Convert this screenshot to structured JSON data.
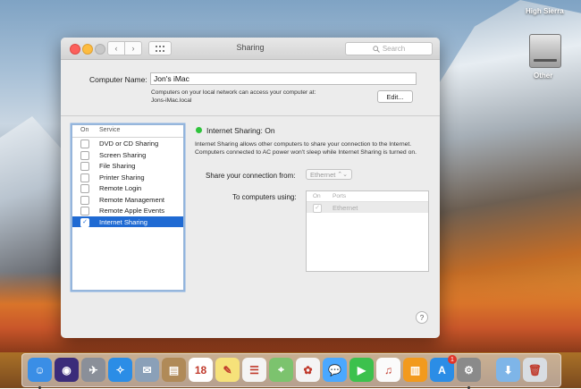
{
  "desktop": {
    "top_label": "High Sierra",
    "drive_label": "Other"
  },
  "window": {
    "title": "Sharing",
    "search_placeholder": "Search",
    "computer_name_label": "Computer Name:",
    "computer_name_value": "Jon's iMac",
    "computer_name_desc_line1": "Computers on your local network can access your computer at:",
    "computer_name_desc_line2": "Jons-iMac.local",
    "edit_button": "Edit...",
    "service_list": {
      "col_on": "On",
      "col_service": "Service",
      "items": [
        {
          "label": "DVD or CD Sharing",
          "checked": false,
          "selected": false
        },
        {
          "label": "Screen Sharing",
          "checked": false,
          "selected": false
        },
        {
          "label": "File Sharing",
          "checked": false,
          "selected": false
        },
        {
          "label": "Printer Sharing",
          "checked": false,
          "selected": false
        },
        {
          "label": "Remote Login",
          "checked": false,
          "selected": false
        },
        {
          "label": "Remote Management",
          "checked": false,
          "selected": false
        },
        {
          "label": "Remote Apple Events",
          "checked": false,
          "selected": false
        },
        {
          "label": "Internet Sharing",
          "checked": true,
          "selected": true
        }
      ]
    },
    "status_text": "Internet Sharing: On",
    "status_color": "#2fc43c",
    "description": "Internet Sharing allows other computers to share your connection to the Internet. Computers connected to AC power won't sleep while Internet Sharing is turned on.",
    "share_from_label": "Share your connection from:",
    "share_from_value": "Ethernet",
    "to_computers_label": "To computers using:",
    "ports_table": {
      "col_on": "On",
      "col_ports": "Ports",
      "rows": [
        {
          "label": "Ethernet",
          "checked": true
        }
      ]
    },
    "help_symbol": "?"
  },
  "dock": {
    "items": [
      {
        "name": "finder-icon",
        "color": "#3a8ee6",
        "glyph": "☺",
        "running": true
      },
      {
        "name": "siri-icon",
        "color": "#3b2c7a",
        "glyph": "◉",
        "running": false
      },
      {
        "name": "launchpad-icon",
        "color": "#8a8f99",
        "glyph": "✈",
        "running": false
      },
      {
        "name": "safari-icon",
        "color": "#2b8de6",
        "glyph": "✧",
        "running": false
      },
      {
        "name": "mail-icon",
        "color": "#8aa0b8",
        "glyph": "✉",
        "running": false
      },
      {
        "name": "contacts-icon",
        "color": "#b08a58",
        "glyph": "▤",
        "running": false
      },
      {
        "name": "calendar-icon",
        "color": "#ffffff",
        "glyph": "18",
        "running": false
      },
      {
        "name": "notes-icon",
        "color": "#f6e27a",
        "glyph": "✎",
        "running": false
      },
      {
        "name": "reminders-icon",
        "color": "#f4f4f4",
        "glyph": "☰",
        "running": false
      },
      {
        "name": "maps-icon",
        "color": "#7cc36e",
        "glyph": "⌖",
        "running": false
      },
      {
        "name": "photos-icon",
        "color": "#f4f4f4",
        "glyph": "✿",
        "running": false
      },
      {
        "name": "messages-icon",
        "color": "#4aa8ff",
        "glyph": "💬",
        "running": false
      },
      {
        "name": "facetime-icon",
        "color": "#3cc14d",
        "glyph": "▶",
        "running": false
      },
      {
        "name": "itunes-icon",
        "color": "#fbfbfb",
        "glyph": "♫",
        "running": false
      },
      {
        "name": "ibooks-icon",
        "color": "#f29a1d",
        "glyph": "▥",
        "running": false
      },
      {
        "name": "app-store-icon",
        "color": "#2b8de6",
        "glyph": "A",
        "running": false
      },
      {
        "name": "system-preferences-icon",
        "color": "#8a8a8a",
        "glyph": "⚙",
        "running": true
      },
      {
        "name": "downloads-folder-icon",
        "color": "#7eb5e8",
        "glyph": "⬇",
        "running": false
      },
      {
        "name": "trash-icon",
        "color": "#d8dde2",
        "glyph": "🗑",
        "running": false
      }
    ],
    "app_store_badge": "1"
  }
}
